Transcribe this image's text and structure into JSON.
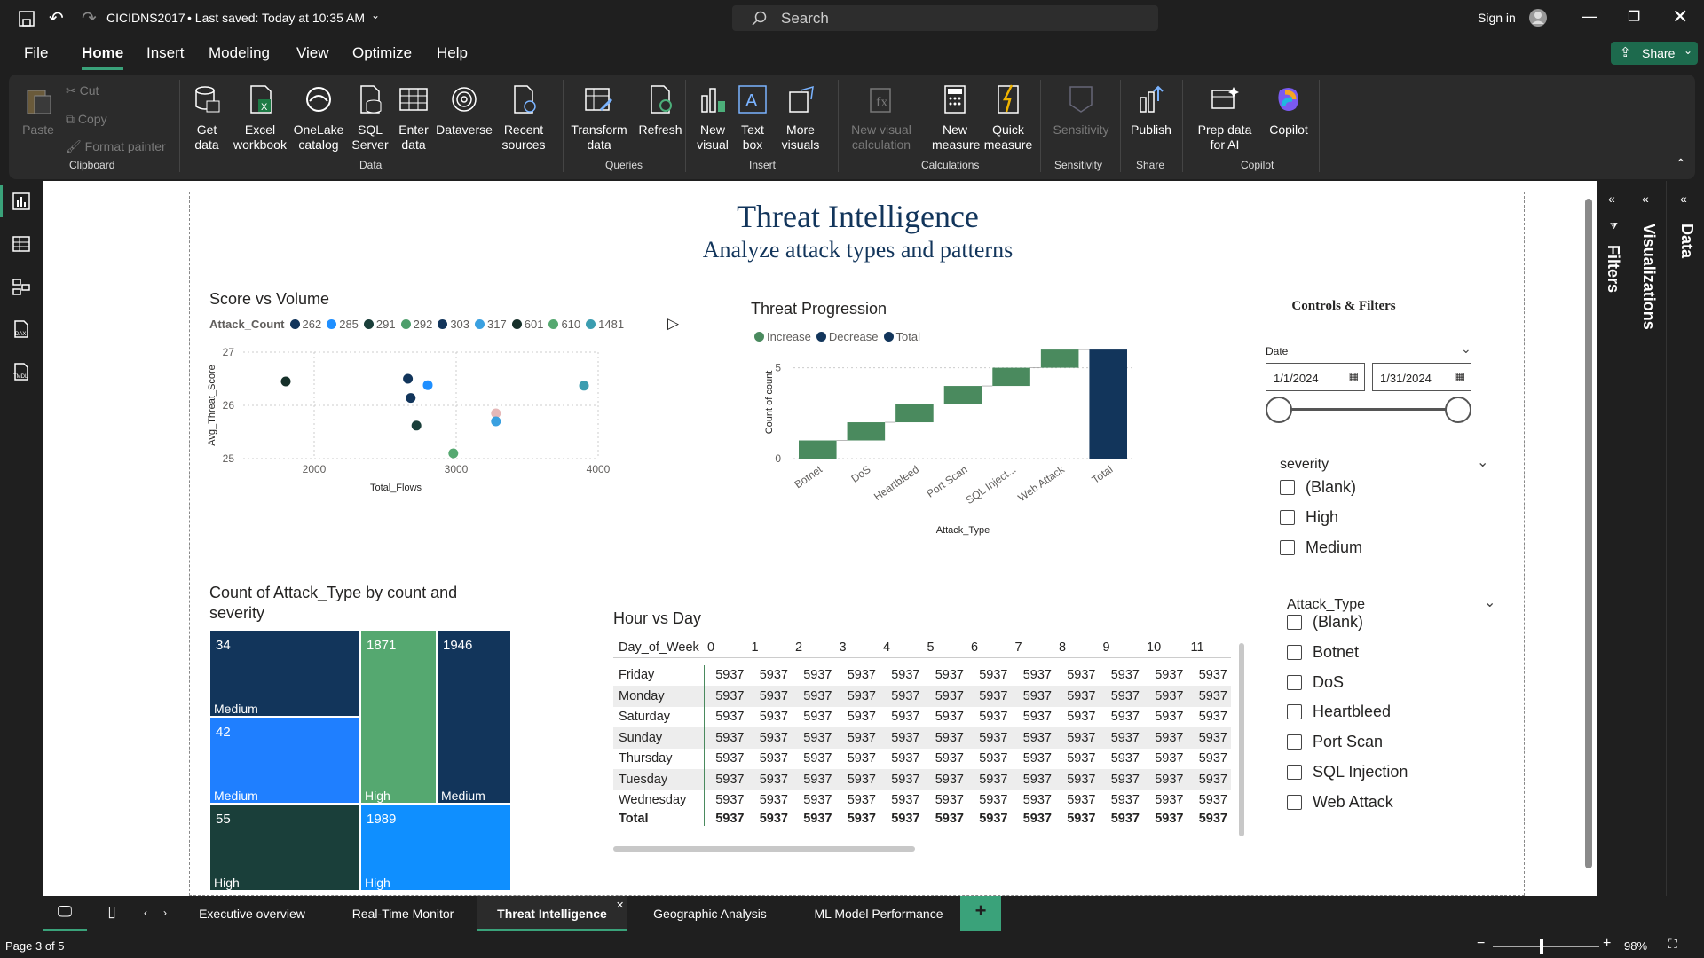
{
  "titlebar": {
    "filename": "CICIDNS2017",
    "saved": "• Last saved: Today at 10:35 AM",
    "search_placeholder": "Search",
    "signin": "Sign in"
  },
  "menu": {
    "items": [
      "File",
      "Home",
      "Insert",
      "Modeling",
      "View",
      "Optimize",
      "Help"
    ],
    "share": "Share"
  },
  "ribbon": {
    "clipboard": {
      "paste": "Paste",
      "cut": "Cut",
      "copy": "Copy",
      "format_painter": "Format painter",
      "group": "Clipboard"
    },
    "data": {
      "get_data": "Get data",
      "excel": "Excel workbook",
      "onelake": "OneLake catalog",
      "sql": "SQL Server",
      "enter_data": "Enter data",
      "dataverse": "Dataverse",
      "recent": "Recent sources",
      "group": "Data"
    },
    "queries": {
      "transform": "Transform data",
      "refresh": "Refresh",
      "group": "Queries"
    },
    "insert": {
      "new_visual": "New visual",
      "text_box": "Text box",
      "more_visuals": "More visuals",
      "group": "Insert"
    },
    "calculations": {
      "new_visual_calc": "New visual calculation",
      "new_measure": "New measure",
      "quick_measure": "Quick measure",
      "group": "Calculations"
    },
    "sensitivity": {
      "label": "Sensitivity",
      "group": "Sensitivity"
    },
    "share": {
      "publish": "Publish",
      "group": "Share"
    },
    "copilot": {
      "prep": "Prep data for AI",
      "copilot": "Copilot",
      "group": "Copilot"
    }
  },
  "report": {
    "title": "Threat Intelligence",
    "subtitle": "Analyze attack types and patterns",
    "scatter": {
      "title": "Score vs Volume",
      "legend_title": "Attack_Count",
      "legend": [
        {
          "label": "262",
          "color": "#12355b"
        },
        {
          "label": "285",
          "color": "#1f8fff"
        },
        {
          "label": "291",
          "color": "#1a3f3a"
        },
        {
          "label": "292",
          "color": "#4d9e6b"
        },
        {
          "label": "303",
          "color": "#12355b"
        },
        {
          "label": "317",
          "color": "#3aa0e0"
        },
        {
          "label": "601",
          "color": "#16302a"
        },
        {
          "label": "610",
          "color": "#55a870"
        },
        {
          "label": "1481",
          "color": "#3b9db0"
        }
      ],
      "xlabel": "Total_Flows",
      "ylabel": "Avg_Threat_Score",
      "xticks": [
        "2000",
        "3000",
        "4000"
      ],
      "yticks": [
        "25",
        "26",
        "27"
      ]
    },
    "waterfall": {
      "title": "Threat Progression",
      "legend": [
        {
          "label": "Increase",
          "color": "#4a8a5e"
        },
        {
          "label": "Decrease",
          "color": "#12355b"
        },
        {
          "label": "Total",
          "color": "#12355b"
        }
      ],
      "xlabel": "Attack_Type",
      "ylabel": "Count of count",
      "yticks": [
        "0",
        "5"
      ]
    },
    "treemap": {
      "title": "Count of Attack_Type by count and severity"
    },
    "matrix": {
      "title": "Hour vs Day",
      "corner": "Day_of_Week",
      "hours": [
        "0",
        "1",
        "2",
        "3",
        "4",
        "5",
        "6",
        "7",
        "8",
        "9",
        "10",
        "11"
      ],
      "rows": [
        {
          "label": "Friday",
          "values": [
            "5937",
            "5937",
            "5937",
            "5937",
            "5937",
            "5937",
            "5937",
            "5937",
            "5937",
            "5937",
            "5937",
            "5937"
          ]
        },
        {
          "label": "Monday",
          "values": [
            "5937",
            "5937",
            "5937",
            "5937",
            "5937",
            "5937",
            "5937",
            "5937",
            "5937",
            "5937",
            "5937",
            "5937"
          ]
        },
        {
          "label": "Saturday",
          "values": [
            "5937",
            "5937",
            "5937",
            "5937",
            "5937",
            "5937",
            "5937",
            "5937",
            "5937",
            "5937",
            "5937",
            "5937"
          ]
        },
        {
          "label": "Sunday",
          "values": [
            "5937",
            "5937",
            "5937",
            "5937",
            "5937",
            "5937",
            "5937",
            "5937",
            "5937",
            "5937",
            "5937",
            "5937"
          ]
        },
        {
          "label": "Thursday",
          "values": [
            "5937",
            "5937",
            "5937",
            "5937",
            "5937",
            "5937",
            "5937",
            "5937",
            "5937",
            "5937",
            "5937",
            "5937"
          ]
        },
        {
          "label": "Tuesday",
          "values": [
            "5937",
            "5937",
            "5937",
            "5937",
            "5937",
            "5937",
            "5937",
            "5937",
            "5937",
            "5937",
            "5937",
            "5937"
          ]
        },
        {
          "label": "Wednesday",
          "values": [
            "5937",
            "5937",
            "5937",
            "5937",
            "5937",
            "5937",
            "5937",
            "5937",
            "5937",
            "5937",
            "5937",
            "5937"
          ]
        }
      ],
      "total": {
        "label": "Total",
        "values": [
          "5937",
          "5937",
          "5937",
          "5937",
          "5937",
          "5937",
          "5937",
          "5937",
          "5937",
          "5937",
          "5937",
          "5937"
        ]
      }
    },
    "controls": {
      "title": "Controls & Filters",
      "date_label": "Date",
      "date_start": "1/1/2024",
      "date_end": "1/31/2024",
      "severity_title": "severity",
      "severity_items": [
        "(Blank)",
        "High",
        "Medium"
      ],
      "attack_title": "Attack_Type",
      "attack_items": [
        "(Blank)",
        "Botnet",
        "DoS",
        "Heartbleed",
        "Port Scan",
        "SQL Injection",
        "Web Attack"
      ]
    }
  },
  "chart_data": [
    {
      "type": "scatter",
      "title": "Score vs Volume",
      "xlabel": "Total_Flows",
      "ylabel": "Avg_Threat_Score",
      "xlim": [
        1500,
        4000
      ],
      "ylim": [
        25,
        27
      ],
      "points": [
        {
          "x": 1800,
          "y": 26.45,
          "color": "#16302a"
        },
        {
          "x": 2660,
          "y": 26.5,
          "color": "#12355b"
        },
        {
          "x": 2680,
          "y": 26.14,
          "color": "#12355b"
        },
        {
          "x": 2800,
          "y": 26.38,
          "color": "#1f8fff"
        },
        {
          "x": 2720,
          "y": 25.62,
          "color": "#1a3f3a"
        },
        {
          "x": 2980,
          "y": 25.1,
          "color": "#55a870"
        },
        {
          "x": 3280,
          "y": 25.85,
          "color": "#e6b8b8"
        },
        {
          "x": 3280,
          "y": 25.7,
          "color": "#3aa0e0"
        },
        {
          "x": 3900,
          "y": 26.37,
          "color": "#3b9db0"
        }
      ]
    },
    {
      "type": "bar",
      "subtype": "waterfall",
      "title": "Threat Progression",
      "categories": [
        "Botnet",
        "DoS",
        "Heartbleed",
        "Port Scan",
        "SQL Inject...",
        "Web Attack",
        "Total"
      ],
      "values": [
        1,
        1,
        1,
        1,
        1,
        1,
        6
      ],
      "ylim": [
        0,
        6.2
      ]
    },
    {
      "type": "heatmap",
      "subtype": "treemap",
      "title": "Count of Attack_Type by count and severity",
      "cells": [
        {
          "value": "34",
          "severity": "Medium",
          "color": "#12355b"
        },
        {
          "value": "42",
          "severity": "Medium",
          "color": "#1f7fff"
        },
        {
          "value": "55",
          "severity": "High",
          "color": "#1a3f3a"
        },
        {
          "value": "1871",
          "severity": "High",
          "color": "#55a870"
        },
        {
          "value": "1946",
          "severity": "Medium",
          "color": "#12355b"
        },
        {
          "value": "1989",
          "severity": "High",
          "color": "#0f8fff"
        }
      ]
    }
  ],
  "pages": {
    "tabs": [
      "Executive overview",
      "Real-Time Monitor",
      "Threat Intelligence",
      "Geographic Analysis",
      "ML Model Performance"
    ],
    "page_info": "Page 3 of 5",
    "zoom": "98%"
  },
  "panes": {
    "filters": "Filters",
    "visualizations": "Visualizations",
    "data": "Data"
  }
}
